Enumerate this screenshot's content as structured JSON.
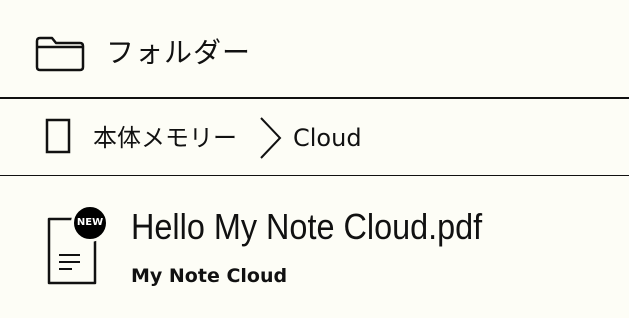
{
  "header": {
    "title": "フォルダー",
    "icon": "folder-icon"
  },
  "breadcrumb": {
    "root_label": "本体メモリー",
    "separator_icon": "chevron-right-icon",
    "current_label": "Cloud",
    "root_icon": "device-icon"
  },
  "files": [
    {
      "name": "Hello My Note Cloud.pdf",
      "location": "My Note Cloud",
      "badge": "NEW",
      "icon": "document-icon"
    }
  ]
}
